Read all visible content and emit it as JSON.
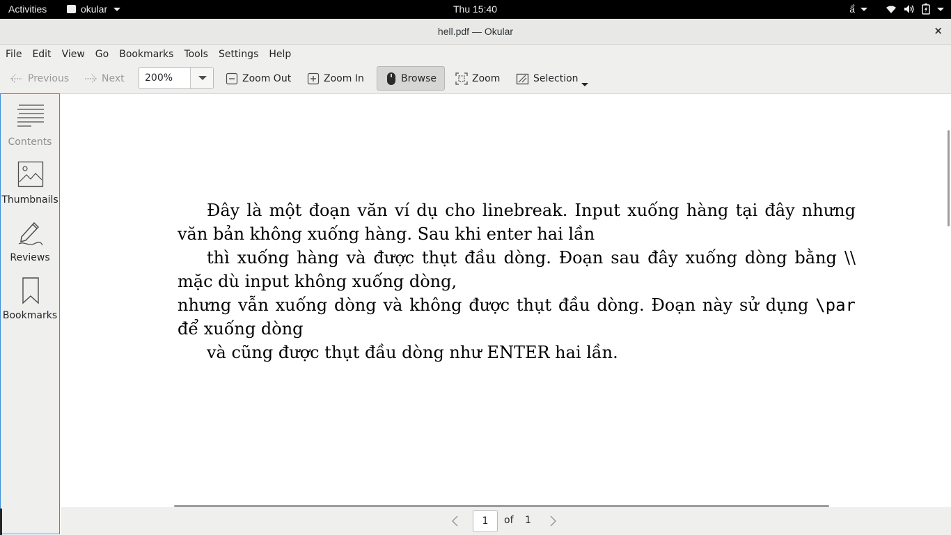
{
  "topbar": {
    "activities": "Activities",
    "app_name": "okular",
    "clock": "Thu 15:40",
    "input_method": "ẩ"
  },
  "window": {
    "title": "hell.pdf — Okular",
    "close_symbol": "×"
  },
  "menubar": {
    "items": [
      "File",
      "Edit",
      "View",
      "Go",
      "Bookmarks",
      "Tools",
      "Settings",
      "Help"
    ]
  },
  "toolbar": {
    "previous": "Previous",
    "next": "Next",
    "zoom_value": "200%",
    "zoom_out": "Zoom Out",
    "zoom_in": "Zoom In",
    "browse": "Browse",
    "zoom": "Zoom",
    "selection": "Selection"
  },
  "sidebar": {
    "items": [
      {
        "label": "Contents",
        "icon": "contents-icon"
      },
      {
        "label": "Thumbnails",
        "icon": "thumbnails-icon"
      },
      {
        "label": "Reviews",
        "icon": "reviews-icon"
      },
      {
        "label": "Bookmarks",
        "icon": "bookmarks-icon"
      }
    ]
  },
  "document": {
    "lines": [
      "Đây là một đoạn văn ví dụ cho linebreak. Input xuống hàng tại đây nhưng",
      "văn bản không xuống hàng. Sau khi enter hai lần",
      "thì xuống hàng và được thụt đầu dòng. Đoạn sau đây xuống dòng bằng \\\\",
      "mặc dù input không xuống dòng,",
      "nhưng vẫn xuống dòng và không được thụt đầu dòng. Đoạn này sử dụng",
      "\\par",
      "để xuống dòng",
      "và cũng được thụt đầu dòng như ENTER hai lần."
    ]
  },
  "pager": {
    "current": "1",
    "of": "of",
    "total": "1"
  },
  "colors": {
    "sidebar_border": "#3b8fd9",
    "topbar_bg": "#000000",
    "chrome_bg": "#efefee"
  }
}
